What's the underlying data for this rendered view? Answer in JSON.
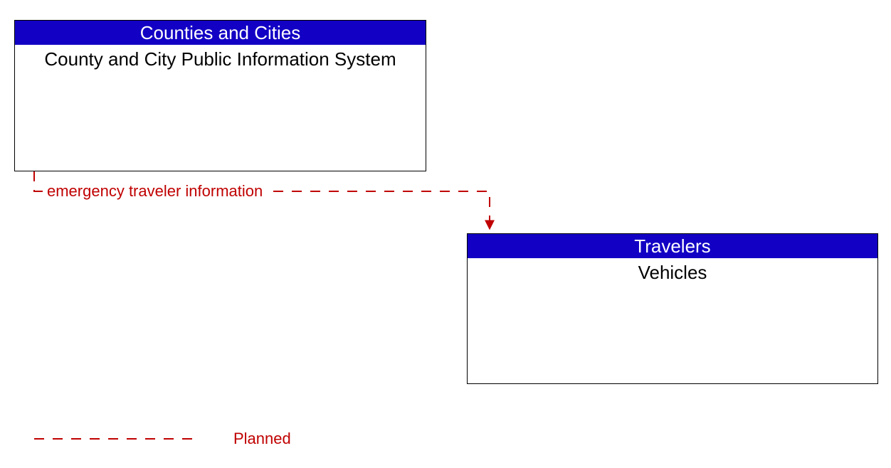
{
  "nodes": {
    "source": {
      "header": "Counties and Cities",
      "body": "County and City Public Information System"
    },
    "target": {
      "header": "Travelers",
      "body": "Vehicles"
    }
  },
  "flow": {
    "label": "emergency traveler information"
  },
  "legend": {
    "planned": "Planned"
  },
  "colors": {
    "header_bg": "#1200c4",
    "flow_stroke": "#c00000"
  }
}
